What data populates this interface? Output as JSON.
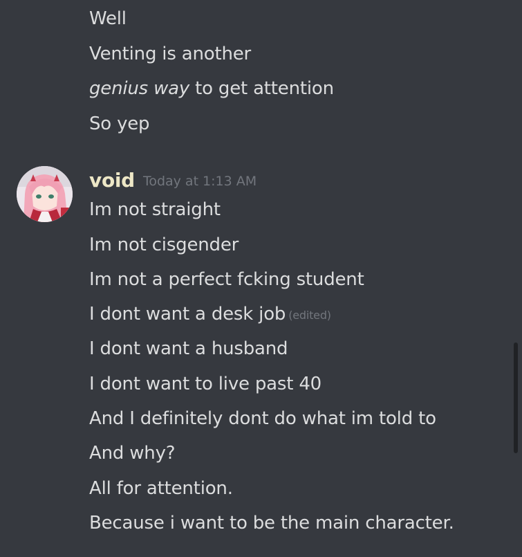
{
  "previous_message": {
    "lines": [
      "Well",
      "Venting is another",
      "So yep"
    ],
    "styled_line": {
      "italic_part": "genius way",
      "rest": " to get attention"
    }
  },
  "message": {
    "username": "void",
    "username_color": "#ede7c6",
    "timestamp": "Today at 1:13 AM",
    "avatar": "anime-girl-avatar",
    "lines": [
      "Im not straight",
      "Im not cisgender",
      "Im not a perfect fcking student",
      "I dont want a desk job",
      "I dont want a husband",
      "I dont want to live past 40",
      "And I definitely dont do what im told to",
      "And why?",
      "All for attention.",
      "Because i want to be the main character."
    ],
    "edited_label": "(edited)"
  },
  "theme": {
    "background": "#36393f",
    "text": "#dcddde",
    "muted": "#72767d"
  }
}
